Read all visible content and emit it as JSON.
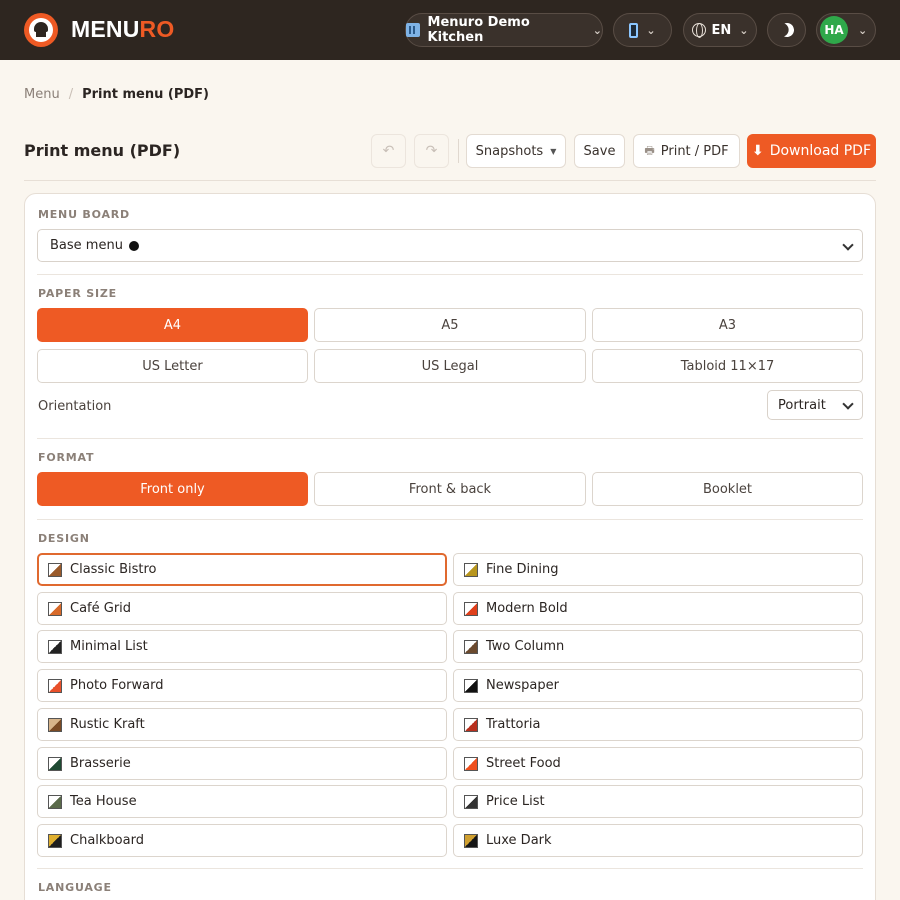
{
  "app": {
    "brand_part1": "MENU",
    "brand_part2": "RO",
    "kitchen_name": "Menuro Demo Kitchen",
    "language": "EN",
    "user_initials": "HA"
  },
  "breadcrumb": {
    "root": "Menu",
    "sep": "/",
    "current": "Print menu (PDF)"
  },
  "header": {
    "title": "Print menu (PDF)",
    "undo": "↶",
    "redo": "↷",
    "snapshots_label": "Snapshots",
    "save_label": "Save",
    "print_label": "Print / PDF",
    "download_label": "Download PDF"
  },
  "menu_board": {
    "label": "MENU BOARD",
    "selected": "Base menu"
  },
  "paper_size": {
    "label": "PAPER SIZE",
    "options": [
      "A4",
      "A5",
      "A3",
      "US Letter",
      "US Legal",
      "Tabloid 11×17"
    ],
    "selected": "A4",
    "orientation_label": "Orientation",
    "orientation_value": "Portrait"
  },
  "format": {
    "label": "FORMAT",
    "options": [
      "Front only",
      "Front & back",
      "Booklet"
    ],
    "selected": "Front only"
  },
  "design": {
    "label": "DESIGN",
    "selected": "Classic Bistro",
    "items": [
      {
        "name": "Classic Bistro",
        "c1": "#ffffff",
        "c2": "#9a5a2a"
      },
      {
        "name": "Fine Dining",
        "c1": "#ffffff",
        "c2": "#b8961e"
      },
      {
        "name": "Café Grid",
        "c1": "#ffffff",
        "c2": "#d86a2a"
      },
      {
        "name": "Modern Bold",
        "c1": "#ffffff",
        "c2": "#e0401c"
      },
      {
        "name": "Minimal List",
        "c1": "#ffffff",
        "c2": "#222222"
      },
      {
        "name": "Two Column",
        "c1": "#ffffff",
        "c2": "#6b4a2e"
      },
      {
        "name": "Photo Forward",
        "c1": "#ffffff",
        "c2": "#e8502a"
      },
      {
        "name": "Newspaper",
        "c1": "#ffffff",
        "c2": "#111111"
      },
      {
        "name": "Rustic Kraft",
        "c1": "#d7b48a",
        "c2": "#7a4a24"
      },
      {
        "name": "Trattoria",
        "c1": "#ffffff",
        "c2": "#b8301e"
      },
      {
        "name": "Brasserie",
        "c1": "#ffffff",
        "c2": "#1e4a32"
      },
      {
        "name": "Street Food",
        "c1": "#ffffff",
        "c2": "#f0501e"
      },
      {
        "name": "Tea House",
        "c1": "#ffffff",
        "c2": "#5a6a4a"
      },
      {
        "name": "Price List",
        "c1": "#ffffff",
        "c2": "#333333"
      },
      {
        "name": "Chalkboard",
        "c1": "#e0b030",
        "c2": "#1e1e1e"
      },
      {
        "name": "Luxe Dark",
        "c1": "#d0a030",
        "c2": "#151515"
      }
    ]
  },
  "language": {
    "label": "LANGUAGE"
  },
  "colors": {
    "accent": "#ee5a24",
    "topbar": "#2e2620",
    "background": "#faf6ef"
  }
}
